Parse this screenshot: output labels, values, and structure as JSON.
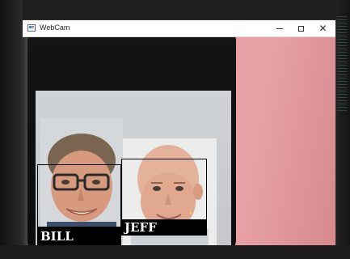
{
  "window": {
    "title": "WebCam",
    "controls": {
      "minimize": "minimize",
      "maximize": "maximize",
      "close": "✕"
    }
  },
  "detections": [
    {
      "label": "BILL"
    },
    {
      "label": "JEFF"
    }
  ],
  "colors": {
    "titlebar": "#ffffff",
    "label_background": "#000000",
    "label_text": "#ffffff",
    "wall": "#e39ba0"
  },
  "icons": {
    "app": "webcam-window-icon",
    "minimize": "minimize-icon",
    "maximize": "maximize-icon",
    "close": "close-icon"
  }
}
